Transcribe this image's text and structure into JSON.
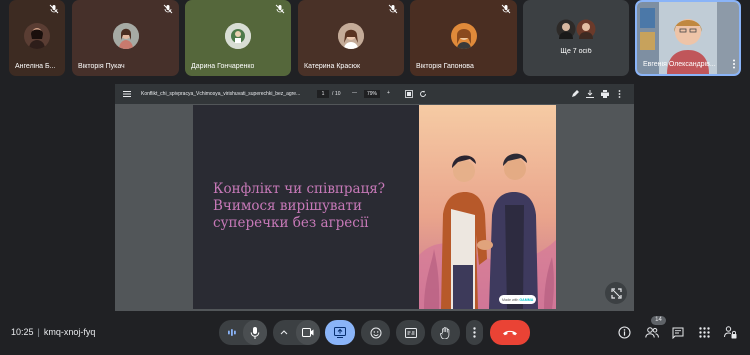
{
  "participants": [
    {
      "name": "Ангеліна Б...",
      "muted": true
    },
    {
      "name": "Вікторія Пукач",
      "muted": true
    },
    {
      "name": "Дарина Гончаренко",
      "muted": true
    },
    {
      "name": "Катерина Красюк",
      "muted": true
    },
    {
      "name": "Вікторія Гапонова",
      "muted": true
    }
  ],
  "more_participants": {
    "label": "Ще 7 осіб"
  },
  "self_view": {
    "name": "Евгенія Олександрів..."
  },
  "viewer": {
    "file_name": "Konflikt_chi_spivpracya_Vchimosya_virishuvati_superechki_bez_agre...",
    "page_current": "1",
    "page_sep": "/",
    "page_total": "10",
    "zoom": "79%",
    "zoom_minus": "—",
    "zoom_plus": "+"
  },
  "slide": {
    "title_lines": [
      "Конфлікт чи співпраця?",
      "Вчимося вирішувати",
      "суперечки без агресії"
    ],
    "badge_prefix": "Made with",
    "badge_brand": "GAMMA"
  },
  "meeting": {
    "time": "10:25",
    "separator": "|",
    "code": "kmq-xnoj-fyq"
  },
  "people_count": "14",
  "colors": {
    "background": "#202124",
    "end_call": "#ea4335",
    "present_active": "#8ab4f8",
    "slide_title": "#c779b8"
  }
}
